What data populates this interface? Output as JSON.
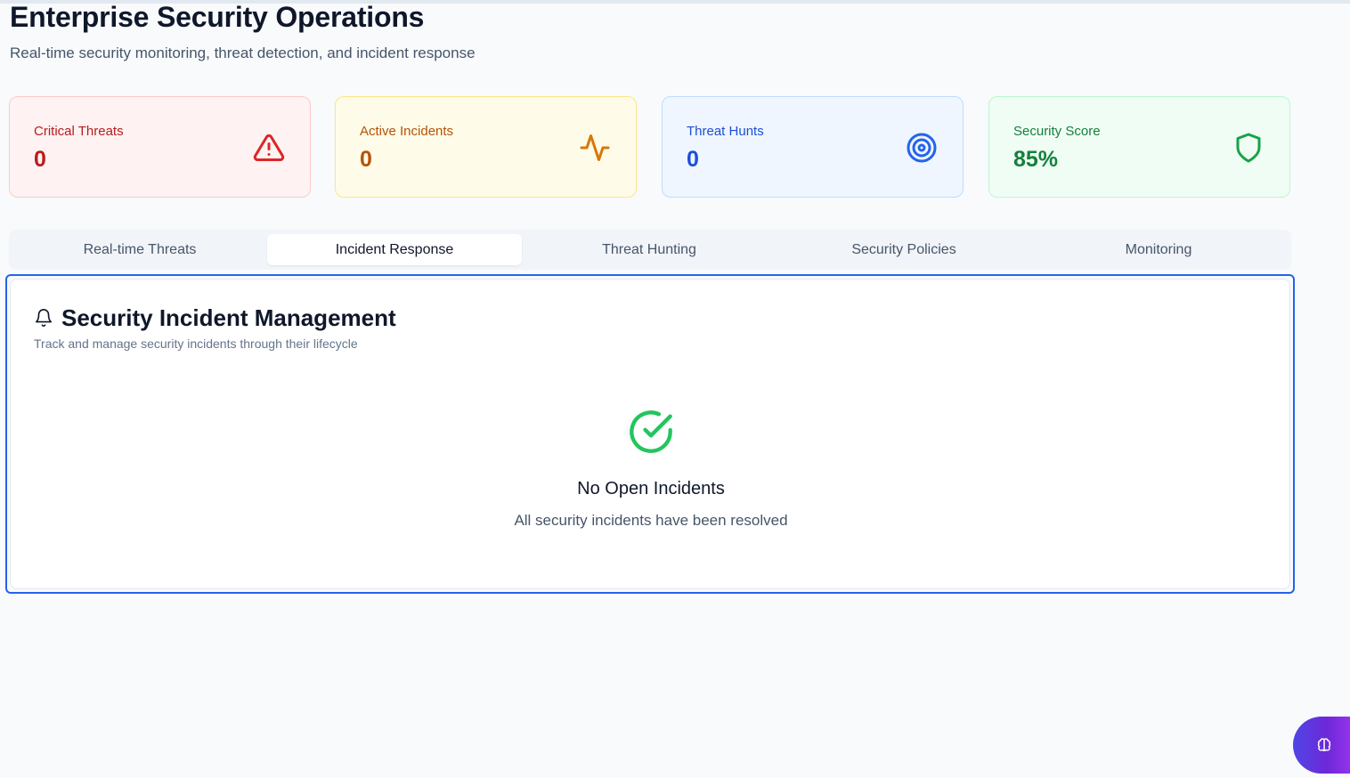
{
  "header": {
    "title": "Enterprise Security Operations",
    "subtitle": "Real-time security monitoring, threat detection, and incident response"
  },
  "stats": [
    {
      "label": "Critical Threats",
      "value": "0",
      "icon": "alert-triangle-icon",
      "color": "#b91c1c"
    },
    {
      "label": "Active Incidents",
      "value": "0",
      "icon": "activity-icon",
      "color": "#b45309"
    },
    {
      "label": "Threat Hunts",
      "value": "0",
      "icon": "target-icon",
      "color": "#1d4ed8"
    },
    {
      "label": "Security Score",
      "value": "85%",
      "icon": "shield-icon",
      "color": "#15803d"
    }
  ],
  "tabs": [
    {
      "label": "Real-time Threats",
      "active": false
    },
    {
      "label": "Incident Response",
      "active": true
    },
    {
      "label": "Threat Hunting",
      "active": false
    },
    {
      "label": "Security Policies",
      "active": false
    },
    {
      "label": "Monitoring",
      "active": false
    }
  ],
  "panel": {
    "icon": "bell-icon",
    "title": "Security Incident Management",
    "description": "Track and manage security incidents through their lifecycle",
    "empty_icon": "check-circle-icon",
    "empty_title": "No Open Incidents",
    "empty_subtitle": "All security incidents have been resolved"
  },
  "fab": {
    "icon": "brain-icon"
  },
  "colors": {
    "accent": "#2563eb",
    "success": "#22c55e",
    "background": "#f8fafc"
  }
}
